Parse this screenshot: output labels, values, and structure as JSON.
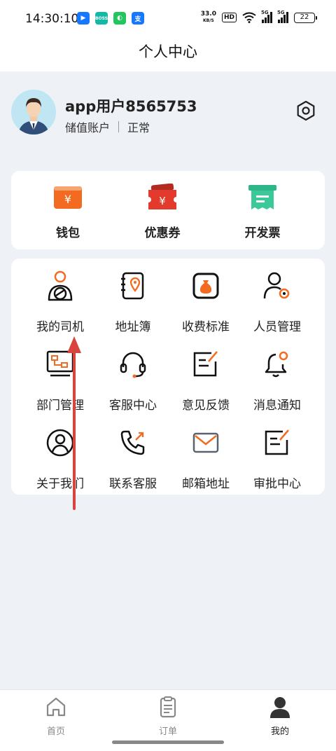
{
  "status": {
    "time": "14:30:10",
    "net_speed_value": "33.0",
    "net_speed_unit": "KB/S",
    "hd": "HD",
    "signal1_label": "5G",
    "signal2_label": "5G",
    "battery": "22",
    "apps": [
      {
        "icon": "navigation-app-icon",
        "color": "#1677ff",
        "text": "▶"
      },
      {
        "icon": "boss-app-icon",
        "color": "#14b8a6",
        "text": "BOSS"
      },
      {
        "icon": "mobile-app-icon",
        "color": "#22c55e",
        "text": "◐"
      },
      {
        "icon": "alipay-app-icon",
        "color": "#1677ff",
        "text": "支"
      }
    ]
  },
  "header": {
    "title": "个人中心"
  },
  "profile": {
    "username": "app用户8565753",
    "account_type": "储值账户",
    "account_status": "正常"
  },
  "quick_actions": [
    {
      "label": "钱包",
      "icon": "wallet-icon"
    },
    {
      "label": "优惠券",
      "icon": "coupon-icon"
    },
    {
      "label": "开发票",
      "icon": "invoice-icon"
    }
  ],
  "menu": [
    {
      "label": "我的司机",
      "icon": "driver-icon"
    },
    {
      "label": "地址簿",
      "icon": "address-book-icon"
    },
    {
      "label": "收费标准",
      "icon": "pricing-icon"
    },
    {
      "label": "人员管理",
      "icon": "staff-management-icon"
    },
    {
      "label": "部门管理",
      "icon": "department-icon"
    },
    {
      "label": "客服中心",
      "icon": "headset-icon"
    },
    {
      "label": "意见反馈",
      "icon": "feedback-icon"
    },
    {
      "label": "消息通知",
      "icon": "bell-icon"
    },
    {
      "label": "关于我们",
      "icon": "about-icon"
    },
    {
      "label": "联系客服",
      "icon": "phone-icon"
    },
    {
      "label": "邮箱地址",
      "icon": "mail-icon"
    },
    {
      "label": "审批中心",
      "icon": "approval-icon"
    }
  ],
  "tabs": [
    {
      "label": "首页",
      "icon": "home-icon",
      "active": false
    },
    {
      "label": "订单",
      "icon": "order-icon",
      "active": false
    },
    {
      "label": "我的",
      "icon": "profile-icon",
      "active": true
    }
  ],
  "colors": {
    "accent_orange": "#f26b21",
    "coupon_red": "#e23b2e",
    "invoice_green": "#2fb58a",
    "annotation_arrow": "#d9443f",
    "background": "#eef1f6"
  }
}
